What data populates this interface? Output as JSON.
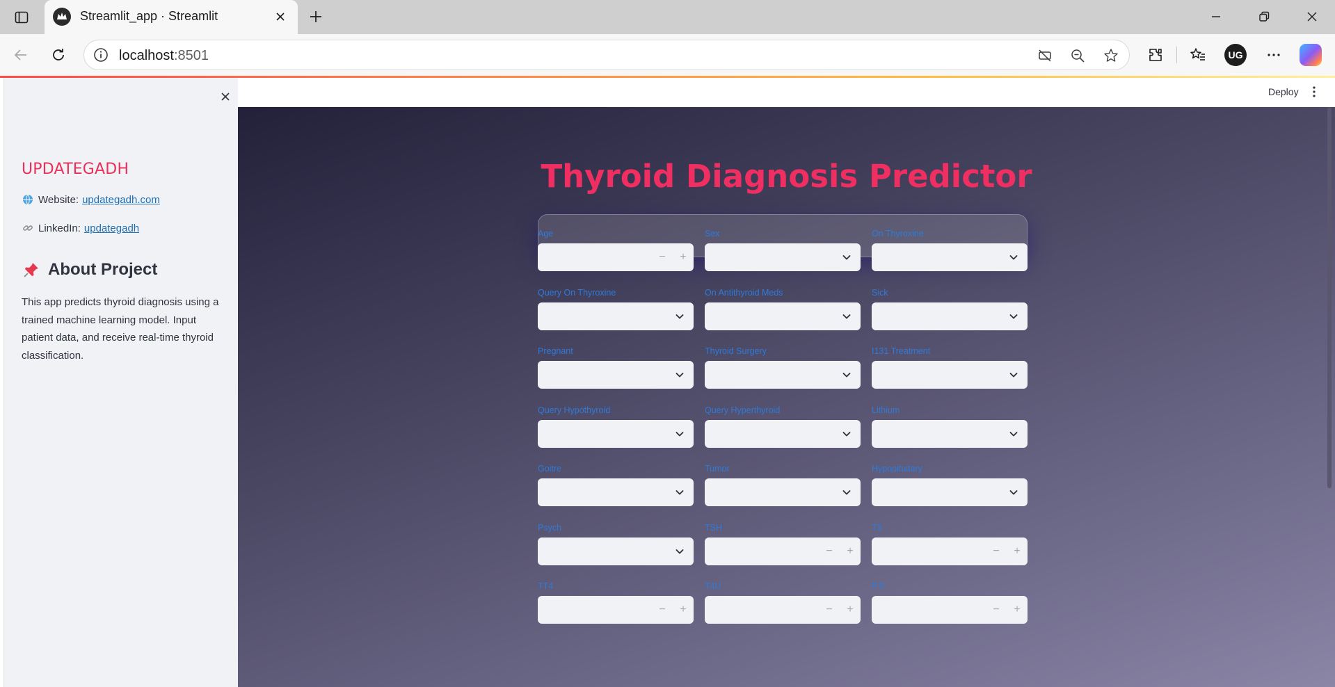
{
  "browser": {
    "tab_title": "Streamlit_app · Streamlit",
    "url_host": "localhost",
    "url_port": ":8501",
    "profile_initials": "UG"
  },
  "header": {
    "deploy_label": "Deploy"
  },
  "sidebar": {
    "brand": "UPDATEGADH",
    "website_label": "Website:",
    "website_link": "updategadh.com",
    "linkedin_label": "LinkedIn:",
    "linkedin_link": "updategadh",
    "about_heading": "About Project",
    "about_text": "This app predicts thyroid diagnosis using a trained machine learning model. Input patient data, and receive real-time thyroid classification."
  },
  "main": {
    "title": "Thyroid Diagnosis Predictor",
    "fields": [
      {
        "label": "Age",
        "type": "number"
      },
      {
        "label": "Sex",
        "type": "select"
      },
      {
        "label": "On Thyroxine",
        "type": "select"
      },
      {
        "label": "Query On Thyroxine",
        "type": "select"
      },
      {
        "label": "On Antithyroid Meds",
        "type": "select"
      },
      {
        "label": "Sick",
        "type": "select"
      },
      {
        "label": "Pregnant",
        "type": "select"
      },
      {
        "label": "Thyroid Surgery",
        "type": "select"
      },
      {
        "label": "I131 Treatment",
        "type": "select"
      },
      {
        "label": "Query Hypothyroid",
        "type": "select"
      },
      {
        "label": "Query Hyperthyroid",
        "type": "select"
      },
      {
        "label": "Lithium",
        "type": "select"
      },
      {
        "label": "Goitre",
        "type": "select"
      },
      {
        "label": "Tumor",
        "type": "select"
      },
      {
        "label": "Hypopituitary",
        "type": "select"
      },
      {
        "label": "Psych",
        "type": "select"
      },
      {
        "label": "TSH",
        "type": "number"
      },
      {
        "label": "T3",
        "type": "number"
      },
      {
        "label": "TT4",
        "type": "number"
      },
      {
        "label": "T4U",
        "type": "number"
      },
      {
        "label": "FTI",
        "type": "number"
      }
    ]
  },
  "colors": {
    "title": "#ef2e62",
    "brand": "#e8305a",
    "label": "#2f7ad9",
    "link": "#1f6fb2"
  },
  "icons": {
    "website": "globe-icon",
    "linkedin": "link-icon",
    "about": "pushpin-icon"
  }
}
